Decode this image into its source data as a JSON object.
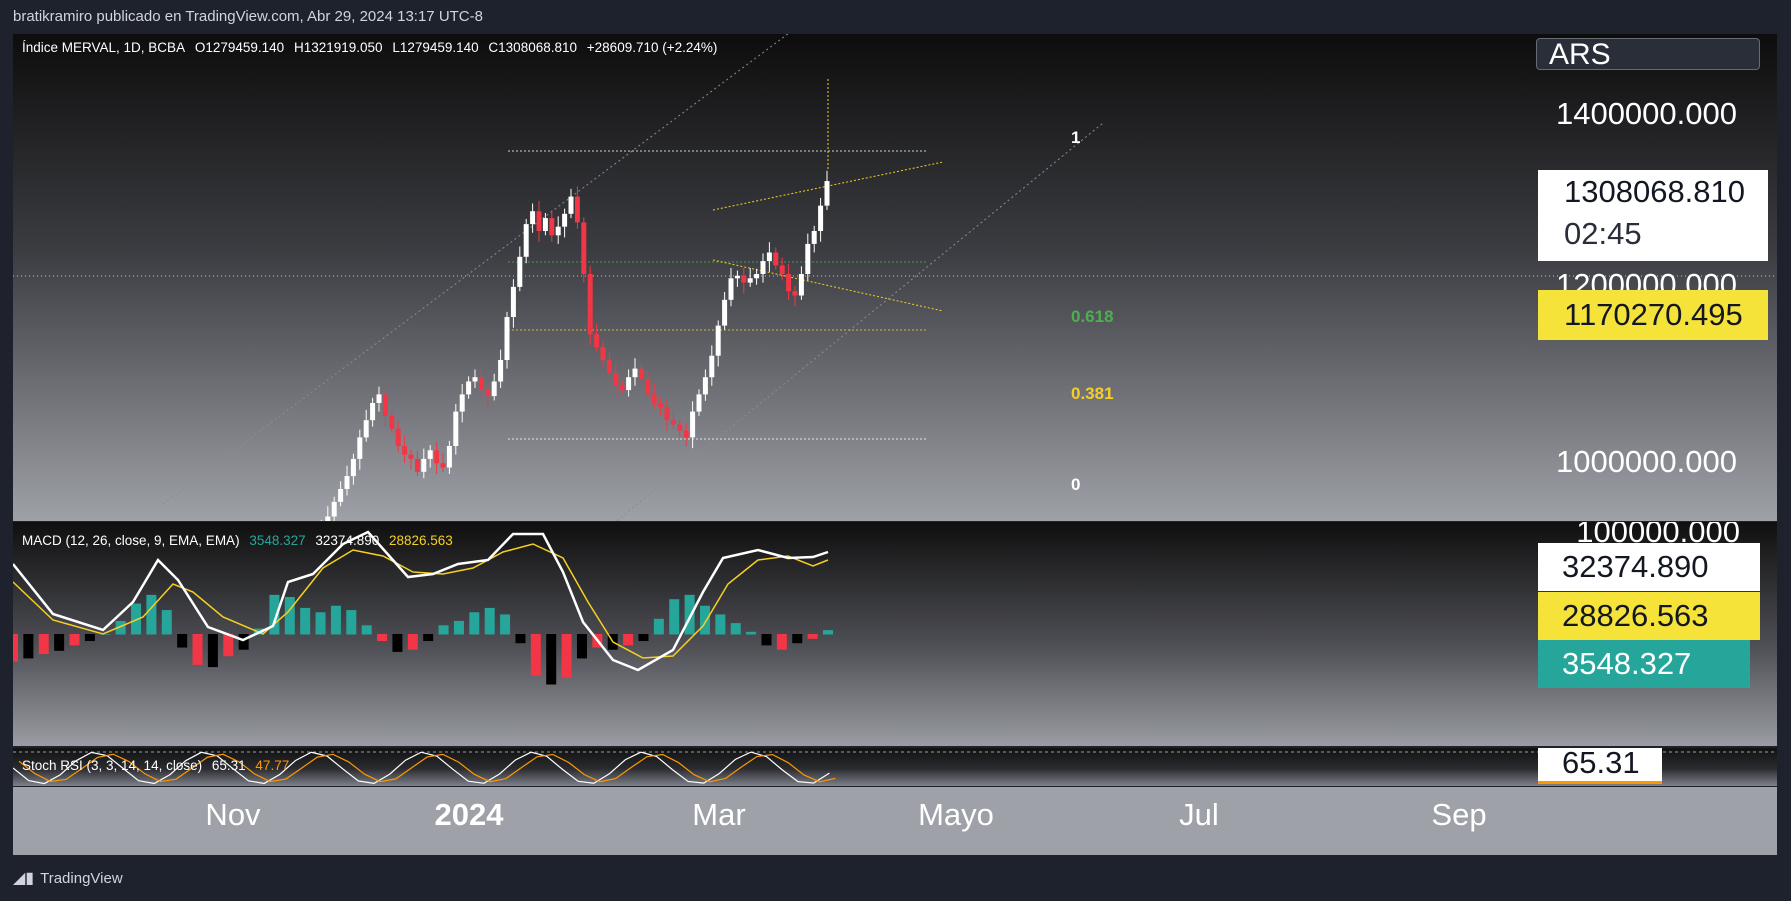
{
  "header": {
    "publisher": "bratikramiro publicado en TradingView.com, Abr 29, 2024 13:17 UTC-8"
  },
  "footer": {
    "brand": "TradingView"
  },
  "currency": "ARS",
  "legend_main": {
    "symbol": "Índice MERVAL, 1D, BCBA",
    "open": "O1279459.140",
    "high": "H1321919.050",
    "low": "L1279459.140",
    "close": "C1308068.810",
    "change": "+28609.710 (+2.24%)"
  },
  "legend_macd": {
    "name": "MACD (12, 26, close, 9, EMA, EMA)",
    "hist": "3548.327",
    "macd": "32374.890",
    "signal": "28826.563"
  },
  "legend_stoch": {
    "name": "Stoch RSI (3, 3, 14, 14, close)",
    "k": "65.31",
    "d": "47.77"
  },
  "price_scale": {
    "ticks": [
      "1400000.000",
      "1200000.000",
      "1000000.000"
    ],
    "cut_tick": "100000.000"
  },
  "badges": {
    "last_price": "1308068.810",
    "countdown": "02:45",
    "crosshair_price": "1170270.495",
    "macd_value": "32374.890",
    "signal_value": "28826.563",
    "hist_value": "3548.327",
    "stoch_value": "65.31"
  },
  "fib_labels": {
    "f1": "1",
    "f0618": "0.618",
    "f0381": "0.381",
    "f0": "0"
  },
  "time_axis": [
    "Nov",
    "2024",
    "Mar",
    "Mayo",
    "Jul",
    "Sep"
  ],
  "colors": {
    "up": "#ffffff",
    "down": "#f23645",
    "macd": "#ffffff",
    "signal": "#f5d020",
    "hist_up": "#26a69a",
    "hist_down": "#f23645",
    "fib_green": "#4caf50",
    "fib_yellow": "#f5d020"
  },
  "chart_data": {
    "type": "candlestick",
    "symbol": "Índice MERVAL",
    "interval": "1D",
    "ylim": [
      950000,
      1420000
    ],
    "close_series": [
      893000,
      905000,
      918000,
      935000,
      950000,
      965000,
      985000,
      1010000,
      1030000,
      1050000,
      1060000,
      1035000,
      1020000,
      1000000,
      990000,
      985000,
      970000,
      985000,
      995000,
      980000,
      975000,
      1000000,
      1040000,
      1060000,
      1075000,
      1080000,
      1065000,
      1058000,
      1075000,
      1100000,
      1150000,
      1185000,
      1220000,
      1258000,
      1273000,
      1250000,
      1265000,
      1245000,
      1255000,
      1270000,
      1290000,
      1260000,
      1200000,
      1130000,
      1115000,
      1100000,
      1085000,
      1070000,
      1065000,
      1080000,
      1090000,
      1078000,
      1060000,
      1050000,
      1045000,
      1030000,
      1025000,
      1018000,
      1010000,
      1040000,
      1060000,
      1080000,
      1105000,
      1140000,
      1170000,
      1195000,
      1198000,
      1190000,
      1195000,
      1200000,
      1215000,
      1225000,
      1210000,
      1200000,
      1180000,
      1175000,
      1200000,
      1235000,
      1250000,
      1279459,
      1308069
    ],
    "macd_hist_sample": [
      -25000,
      -22000,
      -18000,
      -15000,
      -10000,
      -6000,
      0,
      12000,
      28000,
      36000,
      22000,
      -12000,
      -28000,
      -30000,
      -20000,
      -14000,
      5000,
      36000,
      34000,
      24000,
      20000,
      26000,
      22000,
      8000,
      -6000,
      -16000,
      -14000,
      -6000,
      8000,
      12000,
      20000,
      24000,
      18000,
      -8000,
      -38000,
      -46000,
      -40000,
      -22000,
      -12000,
      -14000,
      -10000,
      -6000,
      14000,
      32000,
      36000,
      26000,
      18000,
      10000,
      2000,
      -10000,
      -14000,
      -8000,
      -4000,
      3548
    ]
  }
}
